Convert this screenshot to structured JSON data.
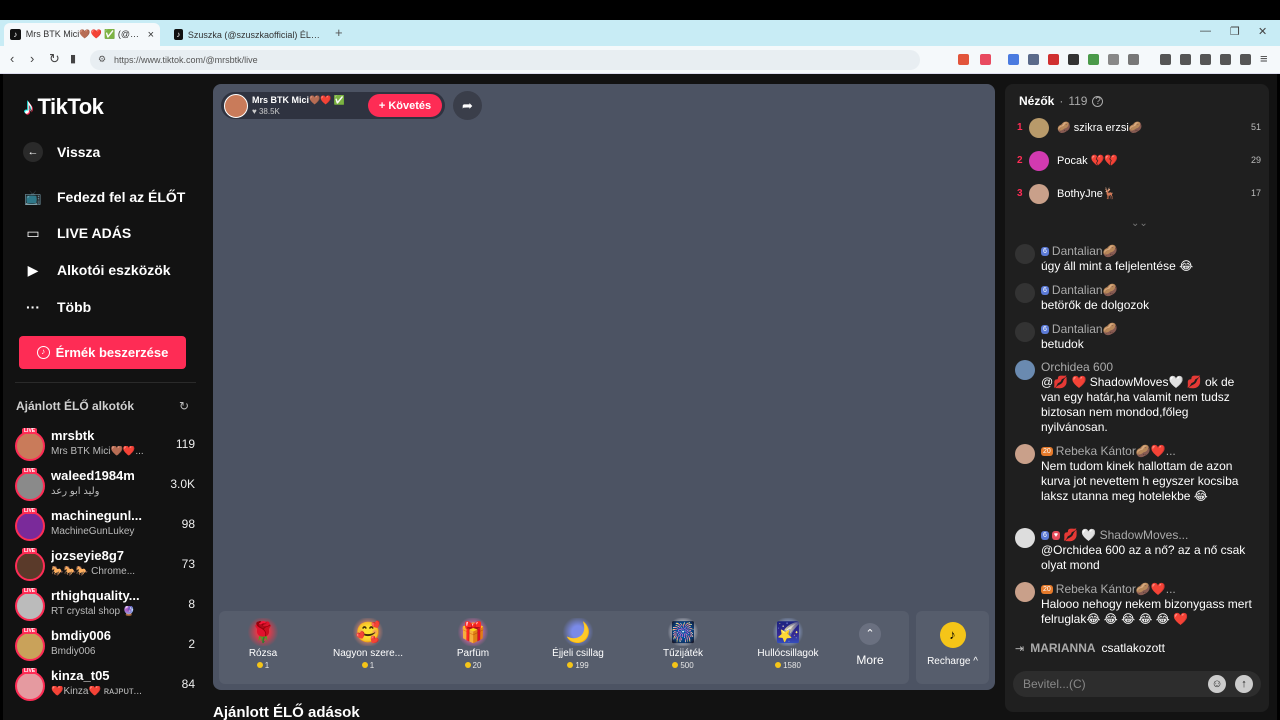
{
  "browser": {
    "tabs": [
      {
        "title": "Mrs BTK Mici🤎❤️ ✅ (@m..."
      },
      {
        "title": "Szuszka (@szuszkaofficial) ÉLŐ adásai..."
      }
    ],
    "new_tab": "+",
    "url": "https://www.tiktok.com/@mrsbtk/live"
  },
  "sidebar": {
    "logo": "TikTok",
    "nav": [
      {
        "label": "Vissza",
        "icon": "back-arrow-icon"
      },
      {
        "label": "Fedezd fel az ÉLŐT",
        "icon": "explore-live-icon"
      },
      {
        "label": "LIVE ADÁS",
        "icon": "video-camera-icon"
      },
      {
        "label": "Alkotói eszközök",
        "icon": "creator-tools-icon"
      },
      {
        "label": "Több",
        "icon": "more-dots-icon"
      }
    ],
    "coin_button": "Érmék beszerzése",
    "recommended_title": "Ajánlott ÉLŐ alkotók",
    "live_badge": "LIVE",
    "recommended": [
      {
        "name": "mrsbtk",
        "sub": "Mrs BTK Mici🤎❤️...",
        "count": "119",
        "color": "#c97b5a"
      },
      {
        "name": "waleed1984m",
        "sub": "وليد ابو رعد",
        "count": "3.0K",
        "color": "#8a8a8a"
      },
      {
        "name": "machinegunl...",
        "sub": "MachineGunLukey",
        "count": "98",
        "color": "#7a2a9a"
      },
      {
        "name": "jozseyie8g7",
        "sub": "🐎🐎🐎 Chrome...",
        "count": "73",
        "color": "#5a3a2a"
      },
      {
        "name": "rthighquality...",
        "sub": "RT crystal shop 🔮",
        "count": "8",
        "color": "#bbbbbb"
      },
      {
        "name": "bmdiy006",
        "sub": "Bmdiy006",
        "count": "2",
        "color": "#c9a25a"
      },
      {
        "name": "kinza_t05",
        "sub": "❤️Kinza❤️ ʀᴀᴊᴘᴜᴛ...",
        "count": "84",
        "color": "#e59aa0"
      }
    ]
  },
  "stream": {
    "host_name": "Mrs BTK Mici🤎❤️ ✅",
    "host_likes": "38.5K",
    "follow_label": "+ Követés",
    "gifts": [
      {
        "name": "Rózsa",
        "price": "1",
        "icon": "🌹"
      },
      {
        "name": "Nagyon szere...",
        "price": "1",
        "icon": "🥰"
      },
      {
        "name": "Parfüm",
        "price": "20",
        "icon": "🎁"
      },
      {
        "name": "Éjjeli csillag",
        "price": "199",
        "icon": "🌙"
      },
      {
        "name": "Tűzijáték",
        "price": "500",
        "icon": "🎆"
      },
      {
        "name": "Hullócsillagok",
        "price": "1580",
        "icon": "🌠"
      }
    ],
    "more_label": "More",
    "recharge_label": "Recharge ^"
  },
  "recommended_live_title": "Ajánlott ÉLŐ adások",
  "chat": {
    "viewers_label": "Nézők",
    "viewers_count": "119",
    "ranking": [
      {
        "rank": "1",
        "name": "🥔 szikra erzsi🥔",
        "score": "51",
        "color": "#b89a6a"
      },
      {
        "rank": "2",
        "name": "Pocak 💔💔",
        "score": "29",
        "color": "#d23ab0"
      },
      {
        "rank": "3",
        "name": "BothyJne🦌",
        "score": "17",
        "color": "#c9a08a"
      }
    ],
    "messages": [
      {
        "badges": [
          "6"
        ],
        "user": "Dantalian🥔",
        "text": "úgy áll mint a feljelentése 😂",
        "avatar": "#333"
      },
      {
        "badges": [
          "6"
        ],
        "user": "Dantalian🥔",
        "text": "betörők de dolgozok",
        "avatar": "#333"
      },
      {
        "badges": [
          "6"
        ],
        "user": "Dantalian🥔",
        "text": "betudok",
        "avatar": "#333"
      },
      {
        "badges": [],
        "user": "Orchidea 600",
        "text": "@💋 ❤️ ShadowMoves🤍 💋 ok de van egy határ,ha valamit nem tudsz biztosan nem mondod,főleg nyilvánosan.",
        "avatar": "#6a8ab0"
      },
      {
        "badges": [
          "20"
        ],
        "user": "Rebeka Kántor🥔❤️...",
        "text": "Nem tudom kinek hallottam de azon kurva jot nevettem h egyszer kocsiba laksz utanna meg hotelekbe 😂",
        "avatar": "#c9a08a"
      },
      {
        "badges": [
          "6",
          "♥"
        ],
        "user": "💋 🤍 ShadowMoves...",
        "text": "@Orchidea 600 az a nő? az a nő csak olyat mond",
        "avatar": "#ddd"
      },
      {
        "badges": [
          "20"
        ],
        "user": "Rebeka Kántor🥔❤️...",
        "text": "Halooo nehogy nekem bizonygass mert felruglak😂 😂 😂 😂 😂 ❤️",
        "avatar": "#c9a08a"
      }
    ],
    "join_user": "MARIANNA",
    "join_text": "csatlakozott",
    "input_placeholder": "Bevitel...(C)"
  }
}
